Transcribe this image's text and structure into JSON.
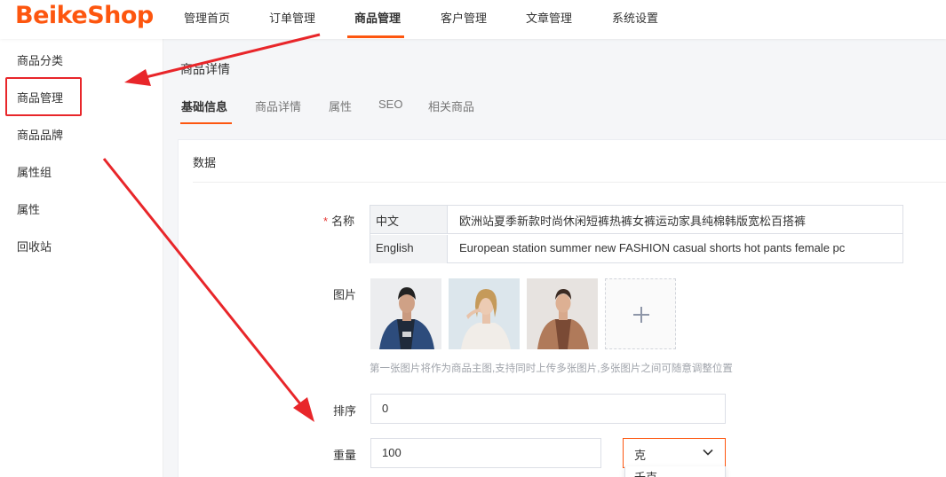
{
  "header": {
    "logo": "BeikeShop",
    "nav": [
      {
        "label": "管理首页"
      },
      {
        "label": "订单管理"
      },
      {
        "label": "商品管理"
      },
      {
        "label": "客户管理"
      },
      {
        "label": "文章管理"
      },
      {
        "label": "系统设置"
      }
    ],
    "active_nav": "商品管理"
  },
  "sidebar": {
    "items": [
      {
        "label": "商品分类"
      },
      {
        "label": "商品管理"
      },
      {
        "label": "商品品牌"
      },
      {
        "label": "属性组"
      },
      {
        "label": "属性"
      },
      {
        "label": "回收站"
      }
    ]
  },
  "page": {
    "title": "商品详情",
    "tabs": [
      {
        "label": "基础信息"
      },
      {
        "label": "商品详情"
      },
      {
        "label": "属性"
      },
      {
        "label": "SEO"
      },
      {
        "label": "相关商品"
      }
    ]
  },
  "form": {
    "section_title": "数据",
    "name": {
      "label": "名称",
      "required_mark": "*",
      "rows": [
        {
          "lang": "中文",
          "value": "欧洲站夏季新款时尚休闲短裤热裤女裤运动家具纯棉韩版宽松百搭裤"
        },
        {
          "lang": "English",
          "value": "European station summer new FASHION casual shorts hot pants female pc"
        }
      ]
    },
    "images": {
      "label": "图片",
      "hint": "第一张图片将作为商品主图,支持同时上传多张图片,多张图片之间可随意调整位置"
    },
    "sort": {
      "label": "排序",
      "value": "0"
    },
    "weight": {
      "label": "重量",
      "value": "100",
      "unit": "克",
      "dropdown_option": "千克"
    }
  },
  "colors": {
    "accent": "#fd560f",
    "annotation": "#e8262a"
  }
}
